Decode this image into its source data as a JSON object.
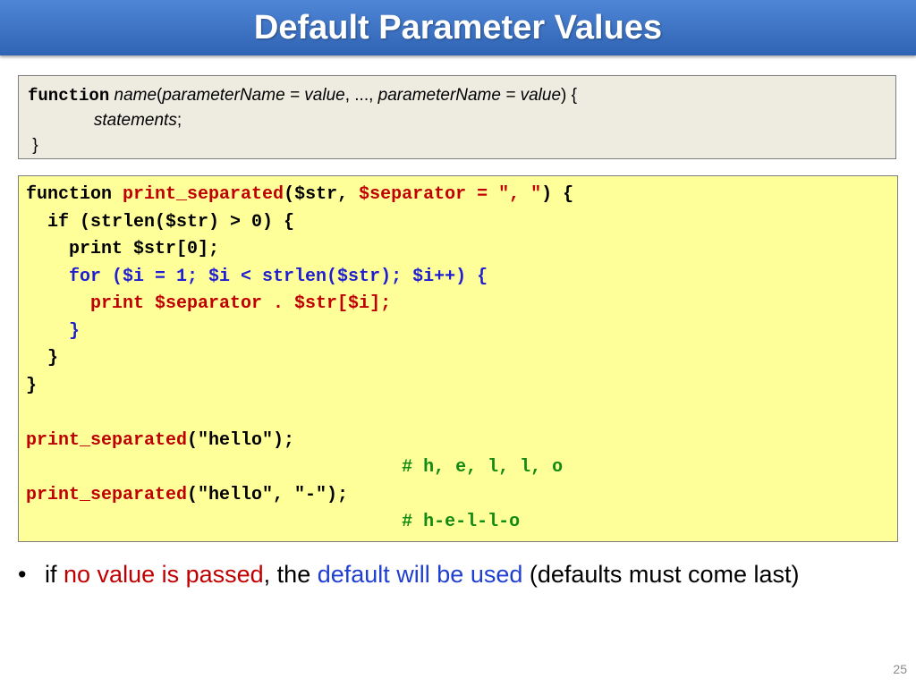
{
  "slide": {
    "title": "Default Parameter Values",
    "page_number": "25"
  },
  "syntax": {
    "keyword": "function",
    "name": "name",
    "open_paren": "(",
    "param1": "parameterName = value",
    "sep": ", ..., ",
    "param2": "parameterName = value",
    "close": ") {",
    "indent": "              ",
    "statements": "statements",
    "semicolon": ";",
    "closing_brace": " }"
  },
  "code": {
    "l1_a": "function ",
    "l1_b": "print_separated",
    "l1_c": "($str, ",
    "l1_d": "$separator = \", \"",
    "l1_e": ") {",
    "l2": "  if (strlen($str) > 0) {",
    "l3": "    print $str[0];",
    "l4": "    for ($i = 1; $i < strlen($str); $i++) {",
    "l5": "      print $separator . $str[$i];",
    "l6": "    }",
    "l7": "  }",
    "l8": "}",
    "l9": "",
    "l10_a": "print_separated",
    "l10_b": "(\"hello\");",
    "l11": "                                   # h, e, l, l, o",
    "l12_a": "print_separated",
    "l12_b": "(\"hello\", \"-\");",
    "l13": "                                   # h-e-l-l-o"
  },
  "bullet": {
    "marker": "•",
    "part1": "if ",
    "part2": "no value is passed",
    "part3": ", the ",
    "part4": "default will be used",
    "part5": " (defaults must come last)"
  }
}
